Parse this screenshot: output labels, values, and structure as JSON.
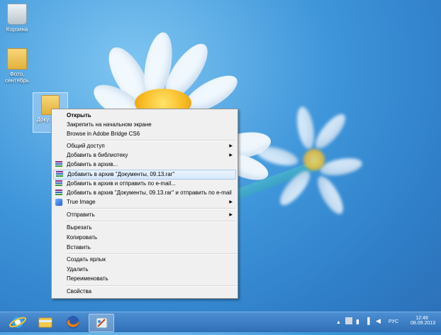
{
  "desktop": {
    "icons": [
      {
        "label": "Корзина",
        "icon": "recycle-bin-icon"
      },
      {
        "label": "Фото, сентябрь",
        "icon": "folder-icon"
      },
      {
        "label": "Доку… 09.",
        "icon": "folder-icon"
      }
    ]
  },
  "context_menu": {
    "items": [
      {
        "label": "Открыть",
        "bold": true
      },
      {
        "label": "Закрепить на начальном экране"
      },
      {
        "label": "Browse in Adobe Bridge CS6"
      },
      {
        "label": "Общий доступ",
        "submenu": true
      },
      {
        "label": "Добавить в библиотеку",
        "submenu": true
      },
      {
        "label": "Добавить в архив...",
        "icon": "winrar-icon"
      },
      {
        "label": "Добавить в архив \"Документы, 09.13.rar\"",
        "icon": "winrar-icon",
        "highlighted": true
      },
      {
        "label": "Добавить в архив и отправить по e-mail...",
        "icon": "winrar-icon"
      },
      {
        "label": "Добавить в архив \"Документы, 09.13.rar\" и отправить по e-mail",
        "icon": "winrar-icon"
      },
      {
        "label": "True Image",
        "icon": "true-image-icon",
        "submenu": true
      },
      {
        "label": "Отправить",
        "submenu": true
      },
      {
        "label": "Вырезать"
      },
      {
        "label": "Копировать"
      },
      {
        "label": "Вставить"
      },
      {
        "label": "Создать ярлык"
      },
      {
        "label": "Удалить"
      },
      {
        "label": "Переименовать"
      },
      {
        "label": "Свойства"
      }
    ]
  },
  "taskbar": {
    "apps": [
      "internet-explorer-icon",
      "file-explorer-icon",
      "firefox-icon",
      "paint-icon"
    ],
    "language": "РУС",
    "time": "12:48",
    "date": "08.09.2013"
  },
  "colors": {
    "highlight": "#d8e9fb",
    "taskbar": "#3a7bc4"
  }
}
